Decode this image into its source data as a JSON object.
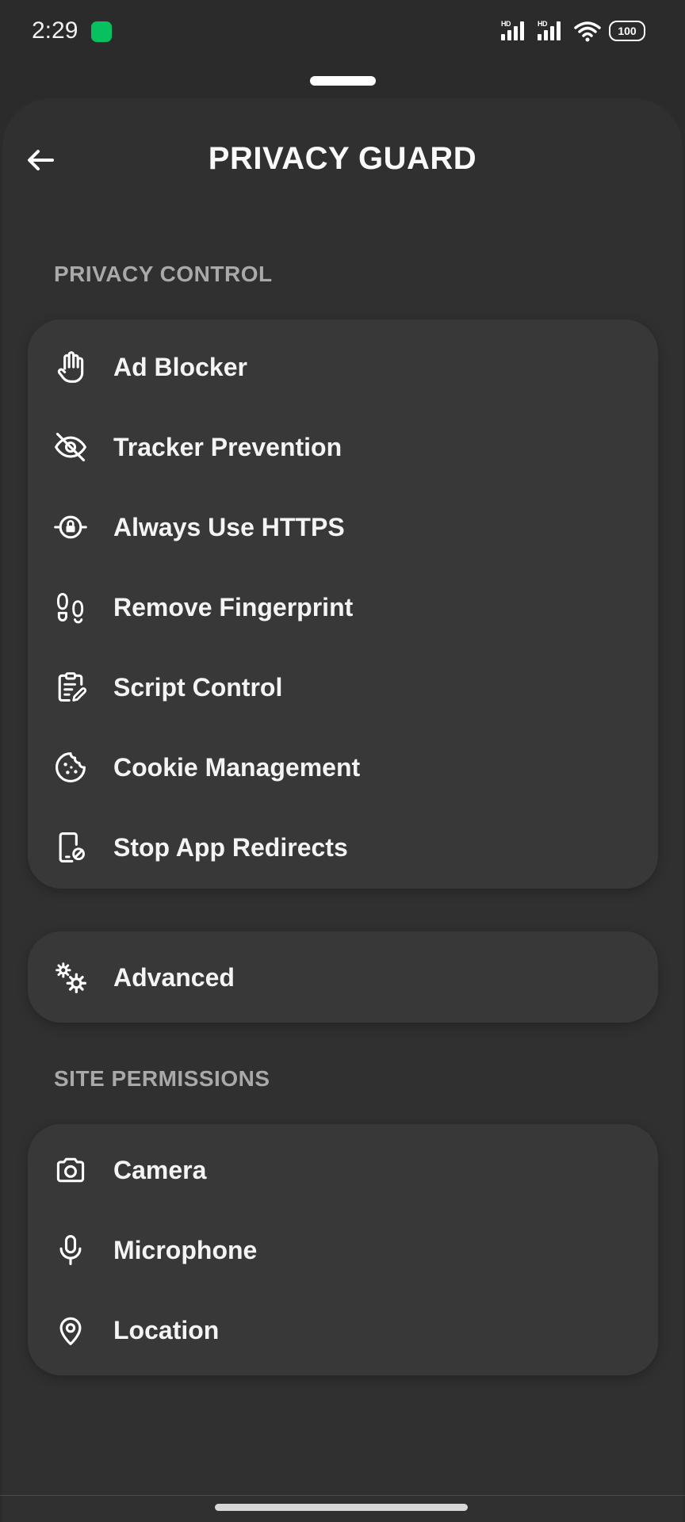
{
  "status_bar": {
    "time": "2:29",
    "signal_1_label": "HD",
    "signal_2_label": "HD",
    "battery": "100"
  },
  "header": {
    "title": "PRIVACY GUARD",
    "back_icon": "arrow-left-icon"
  },
  "privacy_control": {
    "section_label": "PRIVACY CONTROL",
    "items": [
      {
        "label": "Ad Blocker",
        "icon": "hand-stop-icon"
      },
      {
        "label": "Tracker Prevention",
        "icon": "eye-off-icon"
      },
      {
        "label": "Always Use HTTPS",
        "icon": "lock-orbit-icon"
      },
      {
        "label": "Remove Fingerprint",
        "icon": "footprints-icon"
      },
      {
        "label": "Script Control",
        "icon": "clipboard-edit-icon"
      },
      {
        "label": "Cookie Management",
        "icon": "cookie-icon"
      },
      {
        "label": "Stop App Redirects",
        "icon": "phone-block-icon"
      }
    ]
  },
  "advanced": {
    "label": "Advanced",
    "icon": "gears-icon"
  },
  "site_permissions": {
    "section_label": "SITE PERMISSIONS",
    "items": [
      {
        "label": "Camera",
        "icon": "camera-icon"
      },
      {
        "label": "Microphone",
        "icon": "microphone-icon"
      },
      {
        "label": "Location",
        "icon": "map-pin-icon"
      }
    ]
  },
  "colors": {
    "background": "#2b2b2b",
    "sheet": "#303030",
    "card": "#383838",
    "section_label": "#a9a9a9",
    "text": "#f4f4f4"
  }
}
